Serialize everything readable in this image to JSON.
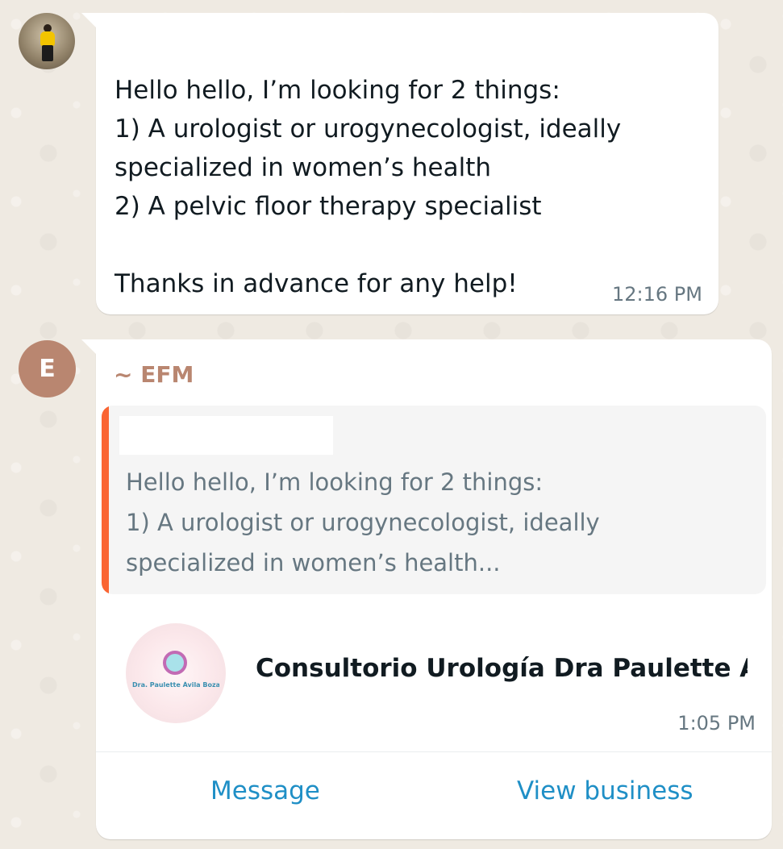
{
  "messages": [
    {
      "text": "Hello hello, I’m looking for 2 things:\n1) A urologist or urogynecologist, ideally specialized in women’s health\n2) A pelvic floor therapy specialist\n\nThanks in advance for any help!",
      "time": "12:16 PM"
    },
    {
      "avatar_letter": "E",
      "sender": "~ EFM",
      "quote_text": "Hello hello, I’m looking for 2 things:\n1) A urologist or urogynecologist, ideally\nspecialized in women’s health...",
      "business": {
        "name": "Consultorio Urología Dra Paulette Á...",
        "logo_text": "Dra. Paulette Ávila Boza"
      },
      "time": "1:05 PM",
      "actions": {
        "message": "Message",
        "view_business": "View business"
      }
    }
  ],
  "colors": {
    "sender_name": "#b98670",
    "quote_bar": "#fa6533",
    "link": "#1f8fc6",
    "background": "#efeae2"
  }
}
